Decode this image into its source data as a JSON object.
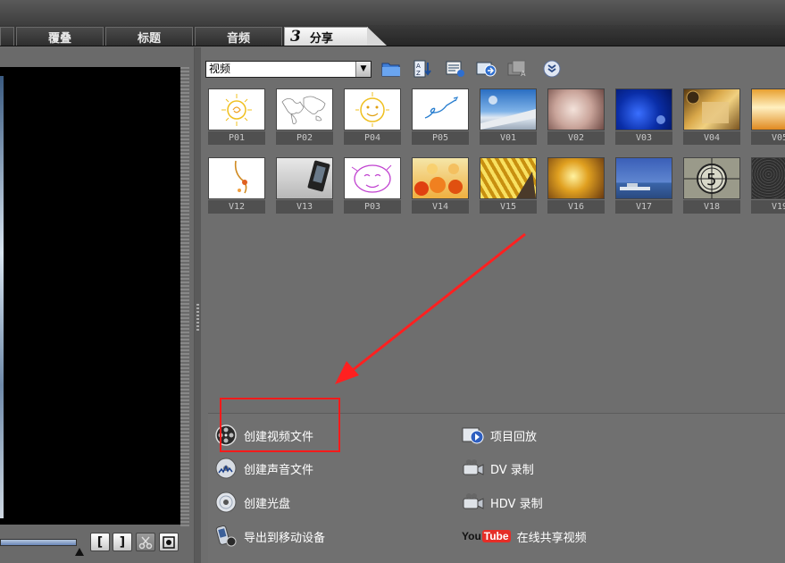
{
  "tabs": [
    {
      "label": "覆叠"
    },
    {
      "label": "标题"
    },
    {
      "label": "音频"
    },
    {
      "number": "3",
      "label": "分享"
    }
  ],
  "library": {
    "category": "视频",
    "thumbnails": [
      {
        "label": "P01"
      },
      {
        "label": "P02"
      },
      {
        "label": "P04"
      },
      {
        "label": "P05"
      },
      {
        "label": "V01"
      },
      {
        "label": "V02"
      },
      {
        "label": "V03"
      },
      {
        "label": "V04"
      },
      {
        "label": "V05"
      },
      {
        "label": "V12"
      },
      {
        "label": "V13"
      },
      {
        "label": "P03"
      },
      {
        "label": "V14"
      },
      {
        "label": "V15"
      },
      {
        "label": "V16"
      },
      {
        "label": "V17"
      },
      {
        "label": "V18"
      },
      {
        "label": "V19"
      }
    ]
  },
  "tasks": {
    "left": [
      {
        "label": "创建视频文件",
        "icon": "film-reel-icon"
      },
      {
        "label": "创建声音文件",
        "icon": "audio-disc-icon"
      },
      {
        "label": "创建光盘",
        "icon": "disc-icon"
      },
      {
        "label": "导出到移动设备",
        "icon": "mobile-device-icon"
      }
    ],
    "right": [
      {
        "label": "项目回放",
        "icon": "playback-icon"
      },
      {
        "label": "DV 录制",
        "icon": "dv-camera-icon"
      },
      {
        "label": "HDV 录制",
        "icon": "hdv-camera-icon"
      },
      {
        "label": "在线共享视频",
        "icon": "youtube-icon"
      }
    ],
    "youtube_logo": {
      "you": "You",
      "tube": "Tube"
    }
  },
  "colors": {
    "highlight": "#ff1a1a",
    "arrow": "#ff2020"
  }
}
